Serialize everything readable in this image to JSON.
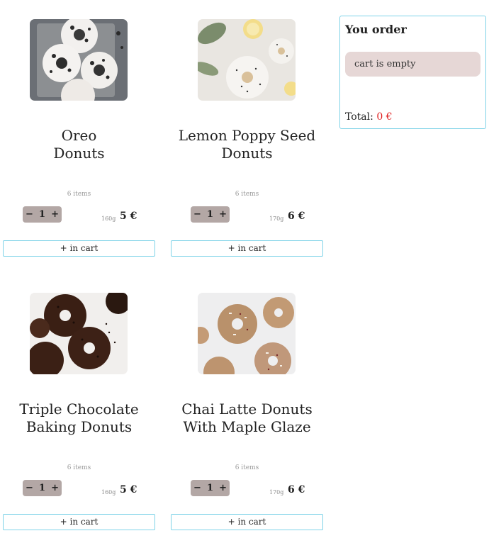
{
  "products": [
    {
      "title_line1": "Oreo",
      "title_line2": "Donuts",
      "items": "6 items",
      "minus": "−",
      "qty": "1",
      "plus": "+",
      "weight": "160g",
      "price": "5 €",
      "add_label": "+ in cart",
      "image": "oreo-donuts-photo"
    },
    {
      "title_line1": "Lemon Poppy Seed",
      "title_line2": "Donuts",
      "items": "6 items",
      "minus": "−",
      "qty": "1",
      "plus": "+",
      "weight": "170g",
      "price": "6 €",
      "add_label": "+ in cart",
      "image": "lemon-poppy-seed-donuts-photo"
    },
    {
      "title_line1": "Triple Chocolate",
      "title_line2": "Baking Donuts",
      "items": "6 items",
      "minus": "−",
      "qty": "1",
      "plus": "+",
      "weight": "160g",
      "price": "5 €",
      "add_label": "+ in cart",
      "image": "triple-chocolate-donuts-photo"
    },
    {
      "title_line1": "Chai Latte Donuts",
      "title_line2": "With Maple Glaze",
      "items": "6 items",
      "minus": "−",
      "qty": "1",
      "plus": "+",
      "weight": "170g",
      "price": "6 €",
      "add_label": "+ in cart",
      "image": "chai-latte-donuts-photo"
    }
  ],
  "order": {
    "title": "You order",
    "empty_text": "cart is empty",
    "total_label": "Total:",
    "total_value": "0 €"
  },
  "colors": {
    "border_accent": "#7fd3e8",
    "stepper_bg": "#b3a7a5",
    "empty_bg": "#e6d7d6",
    "total_value": "#e02020"
  }
}
